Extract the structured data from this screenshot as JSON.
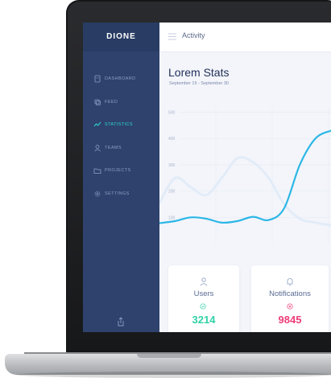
{
  "app": {
    "brand": "DIONE",
    "page_title": "Activity"
  },
  "sidebar": {
    "items": [
      {
        "label": "DASHBOARD",
        "icon": "dashboard-icon",
        "active": false
      },
      {
        "label": "FEED",
        "icon": "feed-icon",
        "active": false
      },
      {
        "label": "STATISTICS",
        "icon": "statistics-icon",
        "active": true
      },
      {
        "label": "TEAMS",
        "icon": "teams-icon",
        "active": false
      },
      {
        "label": "PROJECTS",
        "icon": "projects-icon",
        "active": false
      },
      {
        "label": "SETTINGS",
        "icon": "settings-icon",
        "active": false
      }
    ],
    "bottom_icon": "share-icon"
  },
  "stats": {
    "title": "Lorem Stats",
    "subtitle": "September 15 - September 30"
  },
  "chart_data": {
    "type": "line",
    "title": "Lorem Stats",
    "xlabel": "",
    "ylabel": "",
    "y_ticks": [
      100,
      200,
      300,
      400,
      500
    ],
    "ylim": [
      0,
      520
    ],
    "x": [
      0,
      1,
      2,
      3,
      4,
      5,
      6,
      7,
      8,
      9,
      10,
      11
    ],
    "series": [
      {
        "values": [
          78,
          86,
          100,
          95,
          80,
          86,
          102,
          90,
          135,
          300,
          400,
          430
        ],
        "color": "#2bb7e6"
      },
      {
        "values": [
          155,
          250,
          215,
          185,
          250,
          325,
          310,
          250,
          150,
          95,
          80,
          70
        ],
        "color": "#e2ecf8"
      }
    ],
    "grid": true
  },
  "cards": [
    {
      "label": "Users",
      "value": "3214",
      "icon": "user-icon",
      "badge_icon": "check-circle-icon",
      "color": "#2fd1a8"
    },
    {
      "label": "Notifications",
      "value": "9845",
      "icon": "bell-icon",
      "badge_icon": "x-circle-icon",
      "color": "#ee3d7a"
    }
  ],
  "colors": {
    "sidebar_bg": "#2e426d",
    "accent": "#2fd8d2",
    "line_primary": "#2bb7e6"
  }
}
